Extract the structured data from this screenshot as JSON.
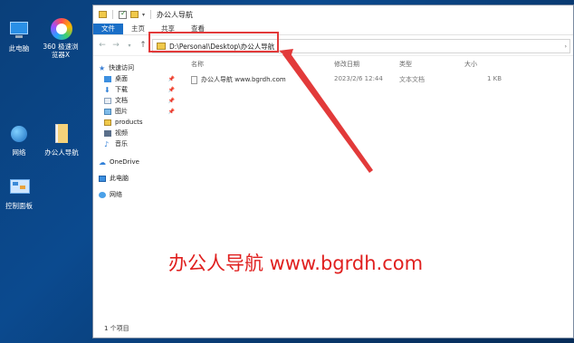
{
  "desktop": {
    "icons": [
      {
        "label": "此电脑",
        "icon": "computer-icon"
      },
      {
        "label": "360 极速浏览器X",
        "icon": "browser-icon"
      },
      {
        "label": "网络",
        "icon": "network-icon"
      },
      {
        "label": "办公人导航",
        "icon": "file-icon"
      },
      {
        "label": "控制面板",
        "icon": "control-panel-icon"
      }
    ]
  },
  "window": {
    "title": "办公人导航",
    "ribbon_tabs": [
      "文件",
      "主页",
      "共享",
      "查看"
    ],
    "address": "D:\\Personal\\Desktop\\办公人导航"
  },
  "sidebar": {
    "items": [
      {
        "label": "快速访问",
        "icon": "star-icon",
        "pinned": false
      },
      {
        "label": "桌面",
        "icon": "desktop-folder-icon",
        "pinned": true
      },
      {
        "label": "下载",
        "icon": "download-icon",
        "pinned": true
      },
      {
        "label": "文档",
        "icon": "documents-icon",
        "pinned": true
      },
      {
        "label": "图片",
        "icon": "pictures-icon",
        "pinned": true
      },
      {
        "label": "products",
        "icon": "folder-icon",
        "pinned": false
      },
      {
        "label": "视频",
        "icon": "video-icon",
        "pinned": false
      },
      {
        "label": "音乐",
        "icon": "music-icon",
        "pinned": false
      },
      {
        "label": "OneDrive",
        "icon": "cloud-icon",
        "pinned": false
      },
      {
        "label": "此电脑",
        "icon": "computer-icon",
        "pinned": false
      },
      {
        "label": "网络",
        "icon": "network-icon",
        "pinned": false
      }
    ]
  },
  "columns": [
    "名称",
    "修改日期",
    "类型",
    "大小"
  ],
  "files": [
    {
      "name": "办公人导航 www.bgrdh.com",
      "date": "2023/2/6 12:44",
      "type": "文本文档",
      "size": "1 KB"
    }
  ],
  "status": "1 个项目",
  "overlay_text": "办公人导航 www.bgrdh.com",
  "colors": {
    "accent": "#1a6fc7",
    "annotation": "#e23a3a"
  }
}
